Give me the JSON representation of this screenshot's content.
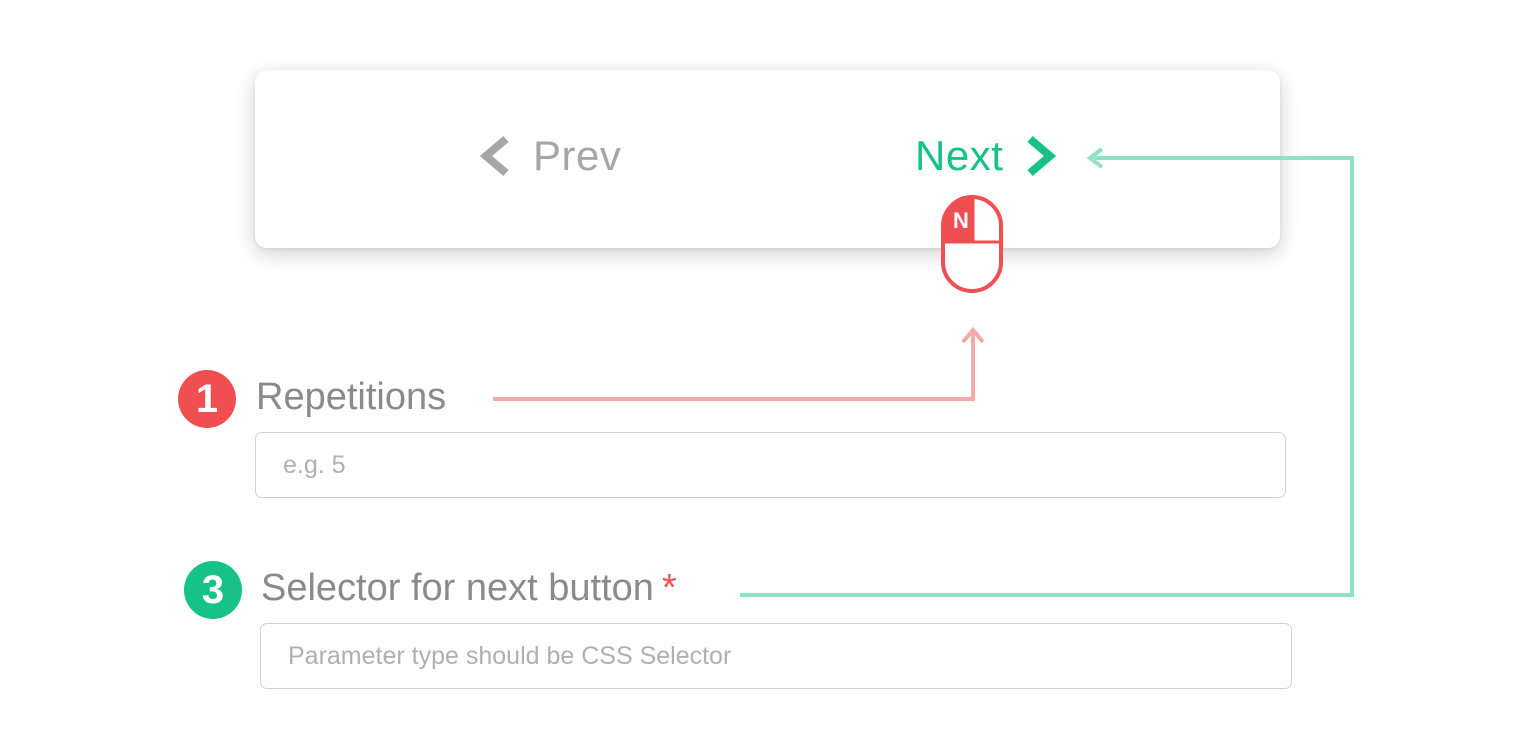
{
  "pager": {
    "prev_label": "Prev",
    "next_label": "Next",
    "prev_color": "#a6a6a6",
    "next_color": "#17c289"
  },
  "mouse": {
    "key_label": "N",
    "color": "#ef4f51"
  },
  "fields": {
    "repetitions": {
      "step": "1",
      "label": "Repetitions",
      "placeholder": "e.g. 5",
      "badge_color": "#ef4f51"
    },
    "next_selector": {
      "step": "3",
      "label": "Selector for next button",
      "required_mark": "*",
      "placeholder": "Parameter type should be CSS Selector",
      "badge_color": "#17c289"
    }
  },
  "connectors": {
    "repetitions_color": "#f5a9aa",
    "selector_color": "#8fe3c4"
  }
}
